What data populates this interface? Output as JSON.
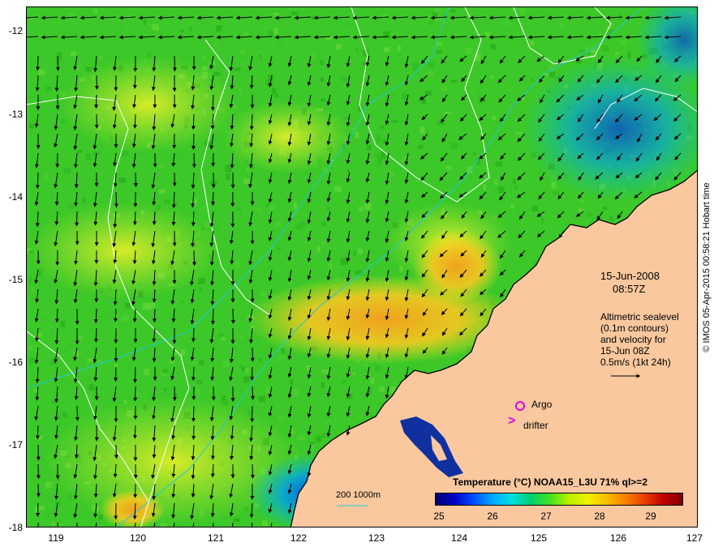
{
  "map": {
    "lat_labels": [
      "-12",
      "-13",
      "-14",
      "-15",
      "-16",
      "-17",
      "-18"
    ],
    "lon_labels": [
      "119",
      "120",
      "121",
      "122",
      "123",
      "124",
      "125",
      "126",
      "127"
    ],
    "date_line1": "15-Jun-2008",
    "date_line2": "08:57Z",
    "info_lines": [
      "Altimetric sealevel",
      "(0.1m contours)",
      "and velocity for",
      "15-Jun 08Z",
      "0.5m/s (1kt 24h)"
    ],
    "argo_label": "Argo",
    "drifter_label": "drifter",
    "drifter_symbol": ">",
    "depth_label": "200  1000m",
    "credit": "© IMOS 05-Apr-2015 00:58:21 Hobart time",
    "colorbar": {
      "title": "Temperature (°C) NOAA15_L3U 71% ql>=2",
      "ticks": [
        "25",
        "26",
        "27",
        "28",
        "29"
      ]
    },
    "colors": {
      "land": "#f9c89f",
      "argo": "#e000e0",
      "depth_contour": "#20c8d8",
      "sealevel_contour": "#ffffff"
    }
  }
}
